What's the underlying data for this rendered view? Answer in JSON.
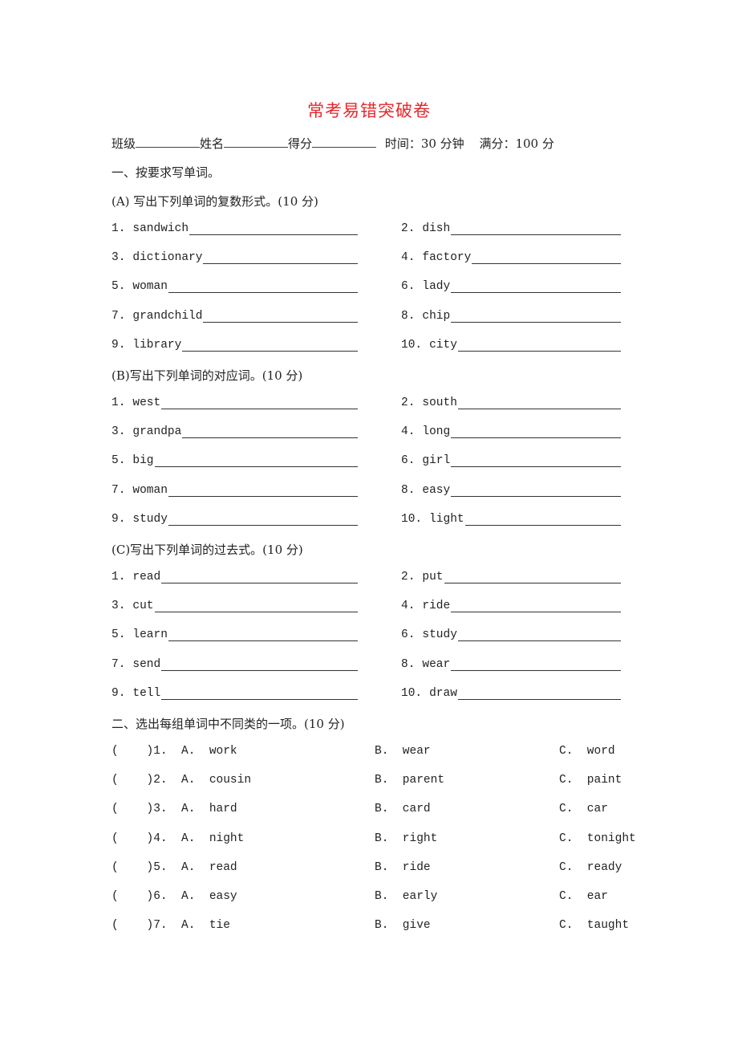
{
  "title": "常考易错突破卷",
  "info": {
    "class_label": "班级",
    "name_label": "姓名",
    "score_label": "得分",
    "time_text": "时间：30 分钟",
    "full_score_text": "满分：100 分"
  },
  "section1": {
    "heading": "一、按要求写单词。",
    "partA": {
      "heading": "(A) 写出下列单词的复数形式。(10 分)",
      "items": [
        {
          "num": "1.",
          "word": "sandwich"
        },
        {
          "num": "2.",
          "word": "dish"
        },
        {
          "num": "3.",
          "word": "dictionary"
        },
        {
          "num": "4.",
          "word": "factory"
        },
        {
          "num": "5.",
          "word": "woman"
        },
        {
          "num": "6.",
          "word": "lady"
        },
        {
          "num": "7.",
          "word": "grandchild"
        },
        {
          "num": "8.",
          "word": "chip"
        },
        {
          "num": "9.",
          "word": "library"
        },
        {
          "num": "10.",
          "word": "city"
        }
      ]
    },
    "partB": {
      "heading": "(B)写出下列单词的对应词。(10 分)",
      "items": [
        {
          "num": "1.",
          "word": "west"
        },
        {
          "num": "2.",
          "word": "south"
        },
        {
          "num": "3.",
          "word": "grandpa"
        },
        {
          "num": "4.",
          "word": "long"
        },
        {
          "num": "5.",
          "word": "big"
        },
        {
          "num": "6.",
          "word": "girl"
        },
        {
          "num": "7.",
          "word": "woman"
        },
        {
          "num": "8.",
          "word": "easy"
        },
        {
          "num": "9.",
          "word": "study"
        },
        {
          "num": "10.",
          "word": "light"
        }
      ]
    },
    "partC": {
      "heading": "(C)写出下列单词的过去式。(10 分)",
      "items": [
        {
          "num": "1.",
          "word": "read"
        },
        {
          "num": "2.",
          "word": "put"
        },
        {
          "num": "3.",
          "word": "cut"
        },
        {
          "num": "4.",
          "word": "ride"
        },
        {
          "num": "5.",
          "word": "learn"
        },
        {
          "num": "6.",
          "word": "study"
        },
        {
          "num": "7.",
          "word": "send"
        },
        {
          "num": "8.",
          "word": "wear"
        },
        {
          "num": "9.",
          "word": "tell"
        },
        {
          "num": "10.",
          "word": "draw"
        }
      ]
    }
  },
  "section2": {
    "heading": "二、选出每组单词中不同类的一项。(10 分)",
    "questions": [
      {
        "prefix": "(    )1.  A.  work",
        "b": "B.  wear",
        "c": "C.  word"
      },
      {
        "prefix": "(    )2.  A.  cousin",
        "b": "B.  parent",
        "c": "C.  paint"
      },
      {
        "prefix": "(    )3.  A.  hard",
        "b": "B.  card",
        "c": "C.  car"
      },
      {
        "prefix": "(    )4.  A.  night",
        "b": "B.  right",
        "c": "C.  tonight"
      },
      {
        "prefix": "(    )5.  A.  read",
        "b": "B.  ride",
        "c": "C.  ready"
      },
      {
        "prefix": "(    )6.  A.  easy",
        "b": "B.  early",
        "c": "C.  ear"
      },
      {
        "prefix": "(    )7.  A.  tie",
        "b": "B.  give",
        "c": "C.  taught"
      }
    ]
  }
}
